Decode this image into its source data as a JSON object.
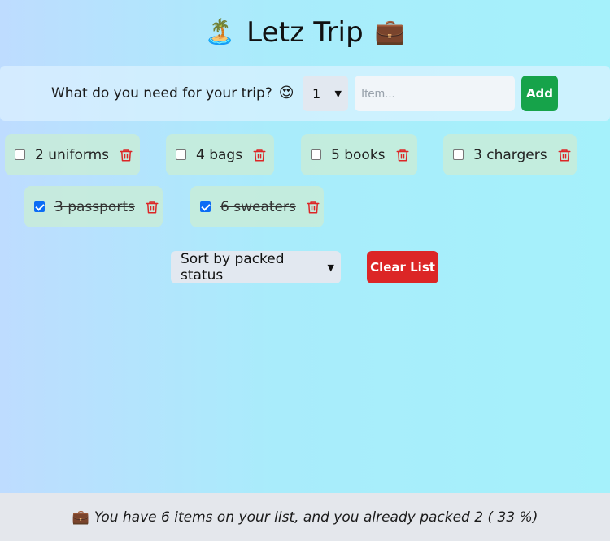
{
  "app": {
    "title": "Letz Trip",
    "title_left_emoji": "🏝️",
    "title_right_emoji": "💼"
  },
  "form": {
    "question": "What do you need for your trip?",
    "question_emoji": "😍",
    "quantity_selected": "1",
    "item_placeholder": "Item...",
    "item_value": "",
    "add_label": "Add"
  },
  "items": [
    {
      "label": "2 uniforms",
      "packed": false
    },
    {
      "label": "4 bags",
      "packed": false
    },
    {
      "label": "5 books",
      "packed": false
    },
    {
      "label": "3 chargers",
      "packed": false
    },
    {
      "label": "3 passports",
      "packed": true
    },
    {
      "label": "6 sweaters",
      "packed": true
    }
  ],
  "controls": {
    "sort_selected": "Sort by packed status",
    "clear_label": "Clear List"
  },
  "footer": {
    "emoji": "💼",
    "text": "You have 6 items on your list, and you already packed 2 ( 33 %)"
  },
  "colors": {
    "add_button": "#16a34a",
    "clear_button": "#dc2626",
    "trash_icon": "#dc2626",
    "checkbox_checked": "#0b6cf5"
  }
}
